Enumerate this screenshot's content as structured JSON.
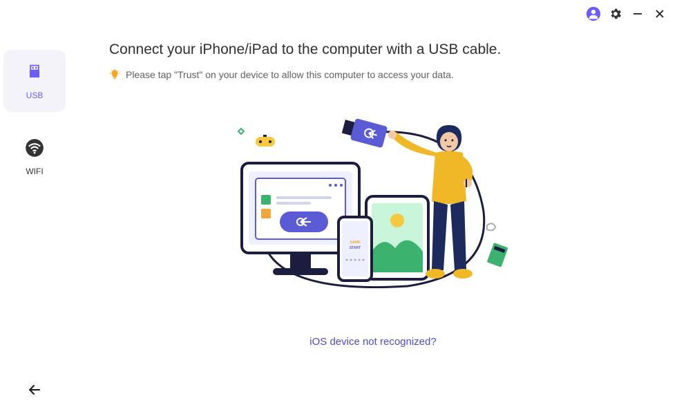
{
  "sidebar": {
    "usb_label": "USB",
    "wifi_label": "WIFI"
  },
  "main": {
    "heading": "Connect your iPhone/iPad to the computer with a USB cable.",
    "hint": "Please tap \"Trust\" on your device to allow this computer to access your data.",
    "help_link": "iOS device not recognized?"
  },
  "colors": {
    "accent": "#6a5cff",
    "link": "#4b4bd9"
  }
}
